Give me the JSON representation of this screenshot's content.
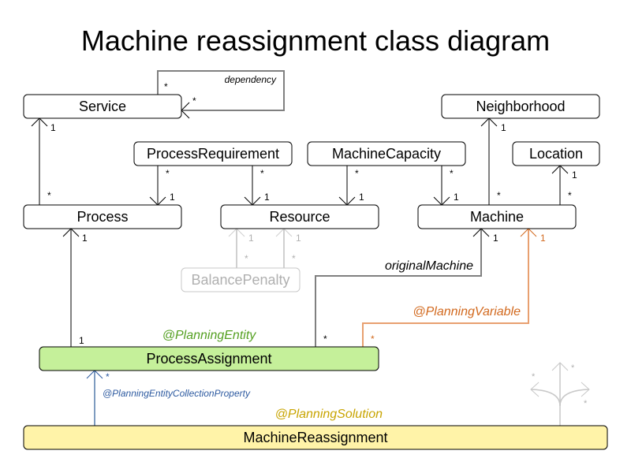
{
  "title": "Machine reassignment class diagram",
  "colors": {
    "planning_entity_fill": "#c5f09a",
    "planning_entity_label": "#55a022",
    "planning_solution_fill": "#fff3a8",
    "planning_solution_label": "#c8a400",
    "planning_variable": "#d2691e",
    "planning_variable_line": "#e8a070",
    "collection_property": "#2d5aa0",
    "collection_line": "#7f9cc0",
    "faded": "#b0b0b0"
  },
  "classes": {
    "service": "Service",
    "neighborhood": "Neighborhood",
    "process_requirement": "ProcessRequirement",
    "machine_capacity": "MachineCapacity",
    "location": "Location",
    "process": "Process",
    "resource": "Resource",
    "machine": "Machine",
    "balance_penalty": "BalancePenalty",
    "process_assignment": "ProcessAssignment",
    "machine_reassignment": "MachineReassignment"
  },
  "annotations": {
    "dependency": "dependency",
    "original_machine": "originalMachine",
    "planning_variable": "@PlanningVariable",
    "planning_entity": "@PlanningEntity",
    "planning_entity_collection_property": "@PlanningEntityCollectionProperty",
    "planning_solution": "@PlanningSolution"
  },
  "multiplicities": {
    "one": "1",
    "many": "*"
  }
}
